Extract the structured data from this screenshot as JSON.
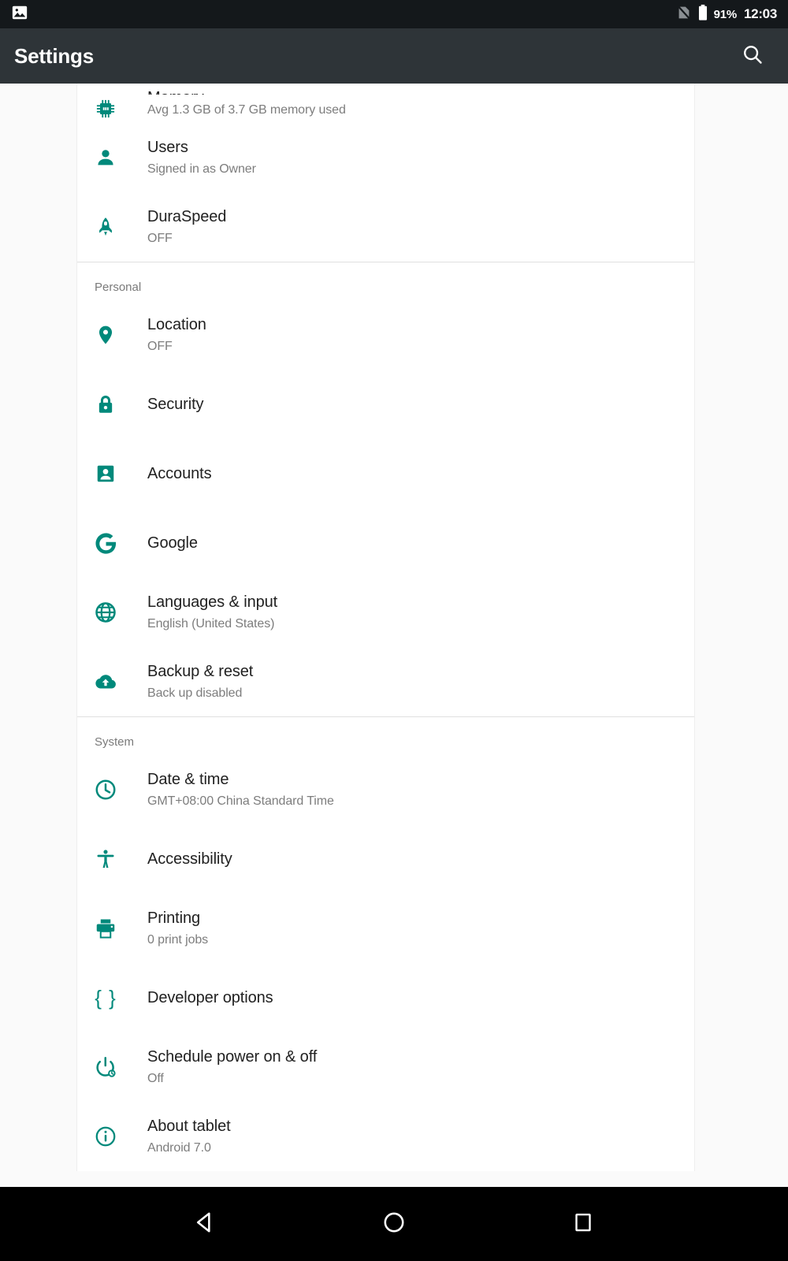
{
  "status_bar": {
    "notification_icon": "image-icon",
    "sim_icon": "no-sim-icon",
    "battery_icon": "battery-icon",
    "battery_percent": "91%",
    "clock": "12:03",
    "background": "#14181b"
  },
  "app_bar": {
    "title": "Settings",
    "search_icon": "search-icon",
    "background": "#2e3438",
    "text_color": "#ffffff"
  },
  "theme": {
    "accent": "#00897b",
    "page_background": "#fafafa",
    "card_background": "#ffffff",
    "title_color": "#212121",
    "subtitle_color": "#7d7d7d",
    "divider": "#e0e0e0"
  },
  "sections": [
    {
      "header": null,
      "rows": [
        {
          "icon": "memory-chip-icon",
          "title": "Memory",
          "subtitle": "Avg 1.3 GB of 3.7 GB memory used",
          "clipped": true
        },
        {
          "icon": "user-icon",
          "title": "Users",
          "subtitle": "Signed in as Owner"
        },
        {
          "icon": "rocket-icon",
          "title": "DuraSpeed",
          "subtitle": "OFF"
        }
      ]
    },
    {
      "header": "Personal",
      "rows": [
        {
          "icon": "location-pin-icon",
          "title": "Location",
          "subtitle": "OFF"
        },
        {
          "icon": "lock-icon",
          "title": "Security",
          "subtitle": null
        },
        {
          "icon": "account-box-icon",
          "title": "Accounts",
          "subtitle": null
        },
        {
          "icon": "google-g-icon",
          "title": "Google",
          "subtitle": null
        },
        {
          "icon": "globe-icon",
          "title": "Languages & input",
          "subtitle": "English (United States)"
        },
        {
          "icon": "cloud-upload-icon",
          "title": "Backup & reset",
          "subtitle": "Back up disabled"
        }
      ]
    },
    {
      "header": "System",
      "rows": [
        {
          "icon": "clock-icon",
          "title": "Date & time",
          "subtitle": "GMT+08:00 China Standard Time"
        },
        {
          "icon": "accessibility-icon",
          "title": "Accessibility",
          "subtitle": null
        },
        {
          "icon": "printer-icon",
          "title": "Printing",
          "subtitle": "0 print jobs"
        },
        {
          "icon": "braces-icon",
          "title": "Developer options",
          "subtitle": null
        },
        {
          "icon": "power-schedule-icon",
          "title": "Schedule power on & off",
          "subtitle": "Off"
        },
        {
          "icon": "info-circle-icon",
          "title": "About tablet",
          "subtitle": "Android 7.0"
        }
      ]
    }
  ],
  "nav_bar": {
    "back_label": "back-button",
    "home_label": "home-button",
    "recents_label": "recents-button",
    "background": "#000000"
  }
}
